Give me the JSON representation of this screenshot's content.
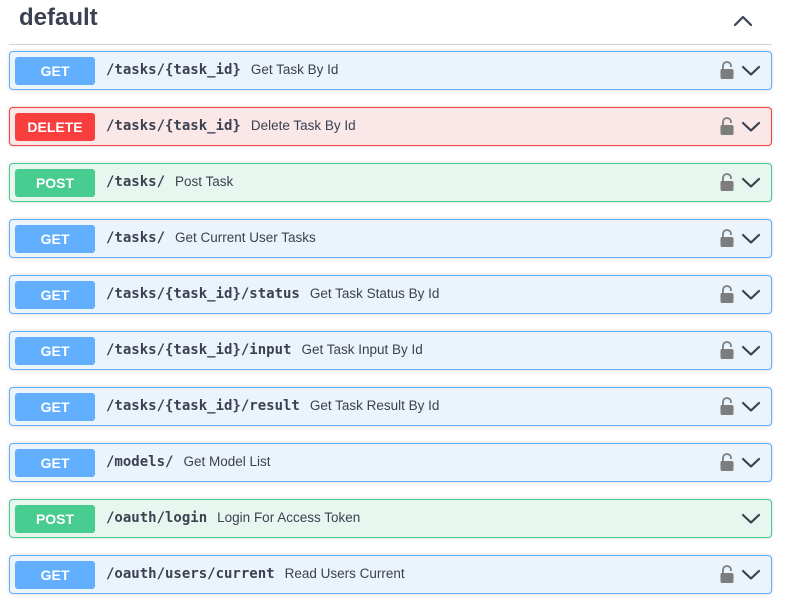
{
  "section": {
    "title": "default",
    "toggle_icon": "chevron-up-icon"
  },
  "colors": {
    "get": "#61affe",
    "post": "#49cc90",
    "delete": "#f93e3e"
  },
  "operations": [
    {
      "method": "GET",
      "path": "/tasks/{task_id}",
      "summary": "Get Task By Id",
      "locked": true
    },
    {
      "method": "DELETE",
      "path": "/tasks/{task_id}",
      "summary": "Delete Task By Id",
      "locked": true
    },
    {
      "method": "POST",
      "path": "/tasks/",
      "summary": "Post Task",
      "locked": true
    },
    {
      "method": "GET",
      "path": "/tasks/",
      "summary": "Get Current User Tasks",
      "locked": true
    },
    {
      "method": "GET",
      "path": "/tasks/{task_id}/status",
      "summary": "Get Task Status By Id",
      "locked": true
    },
    {
      "method": "GET",
      "path": "/tasks/{task_id}/input",
      "summary": "Get Task Input By Id",
      "locked": true
    },
    {
      "method": "GET",
      "path": "/tasks/{task_id}/result",
      "summary": "Get Task Result By Id",
      "locked": true
    },
    {
      "method": "GET",
      "path": "/models/",
      "summary": "Get Model List",
      "locked": true
    },
    {
      "method": "POST",
      "path": "/oauth/login",
      "summary": "Login For Access Token",
      "locked": false
    },
    {
      "method": "GET",
      "path": "/oauth/users/current",
      "summary": "Read Users Current",
      "locked": true
    }
  ]
}
